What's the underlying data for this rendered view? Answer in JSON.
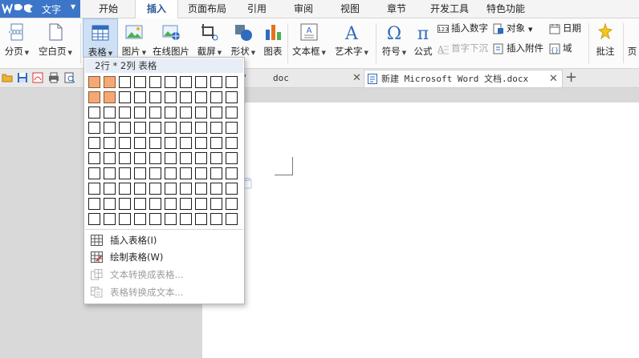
{
  "app": {
    "name": "文字",
    "logo_text": "WPS"
  },
  "tabs": [
    "开始",
    "插入",
    "页面布局",
    "引用",
    "审阅",
    "视图",
    "章节",
    "开发工具",
    "特色功能"
  ],
  "active_tab": "插入",
  "ribbon": {
    "page_break": "分页",
    "blank_page": "空白页",
    "table": "表格",
    "picture": "图片",
    "online_picture": "在线图片",
    "screenshot": "截屏",
    "shapes": "形状",
    "chart": "图表",
    "textbox": "文本框",
    "wordart": "艺术字",
    "symbol": "符号",
    "formula": "公式",
    "insert_number": "插入数字",
    "object": "对象",
    "date": "日期",
    "drop_cap": "首字下沉",
    "attachment": "插入附件",
    "field": "域",
    "comment": "批注",
    "page_more": "页"
  },
  "document_tabs": [
    {
      "name": "doc",
      "active": false
    },
    {
      "name": "新建 Microsoft Word 文档.docx",
      "active": true
    }
  ],
  "table_dropdown": {
    "grid_caption": "2行 * 2列 表格",
    "grid_rows": 10,
    "grid_cols": 10,
    "selected_rows": 2,
    "selected_cols": 2,
    "items": [
      {
        "label": "插入表格(I)",
        "disabled": false
      },
      {
        "label": "绘制表格(W)",
        "disabled": false
      },
      {
        "label": "文本转换成表格...",
        "disabled": true
      },
      {
        "label": "表格转换成文本...",
        "disabled": true
      }
    ]
  },
  "colors": {
    "brand_blue": "#3c76c8",
    "grid_selected": "#f4a974",
    "active_tab_text": "#2b579a"
  }
}
